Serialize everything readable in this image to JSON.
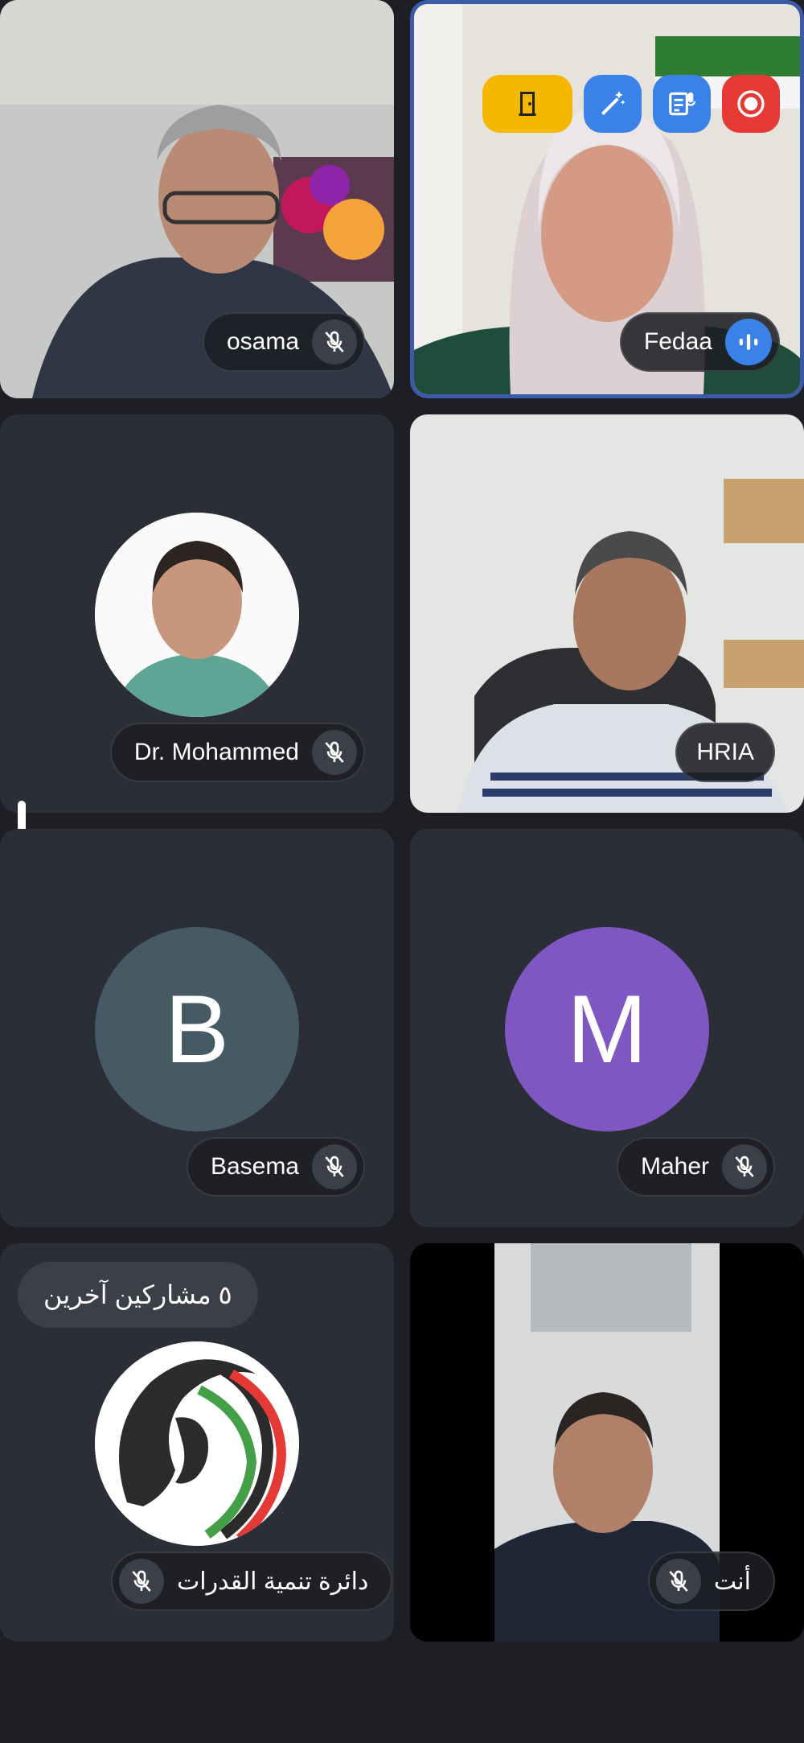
{
  "participants": [
    {
      "name": "osama",
      "mic": "muted",
      "type": "video"
    },
    {
      "name": "Fedaa",
      "mic": "speaking",
      "type": "video"
    },
    {
      "name": "Dr. Mohammed",
      "mic": "muted",
      "type": "photo"
    },
    {
      "name": "HRIA",
      "mic": "none",
      "type": "video"
    },
    {
      "name": "Basema",
      "mic": "muted",
      "type": "initial",
      "initial": "B",
      "color": "#455a64"
    },
    {
      "name": "Maher",
      "mic": "muted",
      "type": "initial",
      "initial": "M",
      "color": "#7e57c2"
    },
    {
      "name": "دائرة تنمية القدرات",
      "mic": "muted",
      "type": "logo"
    },
    {
      "name": "أنت",
      "mic": "muted",
      "type": "self-video"
    }
  ],
  "others_pill": "٥ مشاركين آخرين",
  "top_controls": [
    {
      "icon": "door-icon",
      "color": "#f5b800"
    },
    {
      "icon": "magic-wand-icon",
      "color": "#3b82e8"
    },
    {
      "icon": "transcript-icon",
      "color": "#3b82e8"
    },
    {
      "icon": "record-icon",
      "color": "#e53935"
    }
  ],
  "colors": {
    "background": "#1e1f24",
    "tile": "#2b2d37",
    "active_border": "#3b5ba9"
  }
}
